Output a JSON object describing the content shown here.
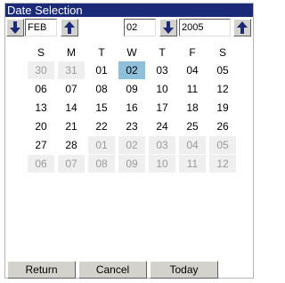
{
  "window": {
    "title": "Date Selection"
  },
  "controls": {
    "month_value": "FEB",
    "day_value": "02",
    "year_value": "2005"
  },
  "calendar": {
    "weekdays": [
      "S",
      "M",
      "T",
      "W",
      "T",
      "F",
      "S"
    ],
    "weeks": [
      [
        {
          "d": "30",
          "other": true
        },
        {
          "d": "31",
          "other": true
        },
        {
          "d": "01"
        },
        {
          "d": "02",
          "selected": true
        },
        {
          "d": "03"
        },
        {
          "d": "04"
        },
        {
          "d": "05"
        }
      ],
      [
        {
          "d": "06"
        },
        {
          "d": "07"
        },
        {
          "d": "08"
        },
        {
          "d": "09"
        },
        {
          "d": "10"
        },
        {
          "d": "11"
        },
        {
          "d": "12"
        }
      ],
      [
        {
          "d": "13"
        },
        {
          "d": "14"
        },
        {
          "d": "15"
        },
        {
          "d": "16"
        },
        {
          "d": "17"
        },
        {
          "d": "18"
        },
        {
          "d": "19"
        }
      ],
      [
        {
          "d": "20"
        },
        {
          "d": "21"
        },
        {
          "d": "22"
        },
        {
          "d": "23"
        },
        {
          "d": "24"
        },
        {
          "d": "25"
        },
        {
          "d": "26"
        }
      ],
      [
        {
          "d": "27"
        },
        {
          "d": "28"
        },
        {
          "d": "01",
          "other": true
        },
        {
          "d": "02",
          "other": true
        },
        {
          "d": "03",
          "other": true
        },
        {
          "d": "04",
          "other": true
        },
        {
          "d": "05",
          "other": true
        }
      ],
      [
        {
          "d": "06",
          "other": true
        },
        {
          "d": "07",
          "other": true
        },
        {
          "d": "08",
          "other": true
        },
        {
          "d": "09",
          "other": true
        },
        {
          "d": "10",
          "other": true
        },
        {
          "d": "11",
          "other": true
        },
        {
          "d": "12",
          "other": true
        }
      ]
    ]
  },
  "buttons": {
    "return_label": "Return",
    "cancel_label": "Cancel",
    "today_label": "Today"
  },
  "colors": {
    "titlebar": "#1b2a78",
    "selected_day": "#8ec0dc",
    "other_month_bg": "#efefef",
    "arrow": "#1b2a78"
  }
}
